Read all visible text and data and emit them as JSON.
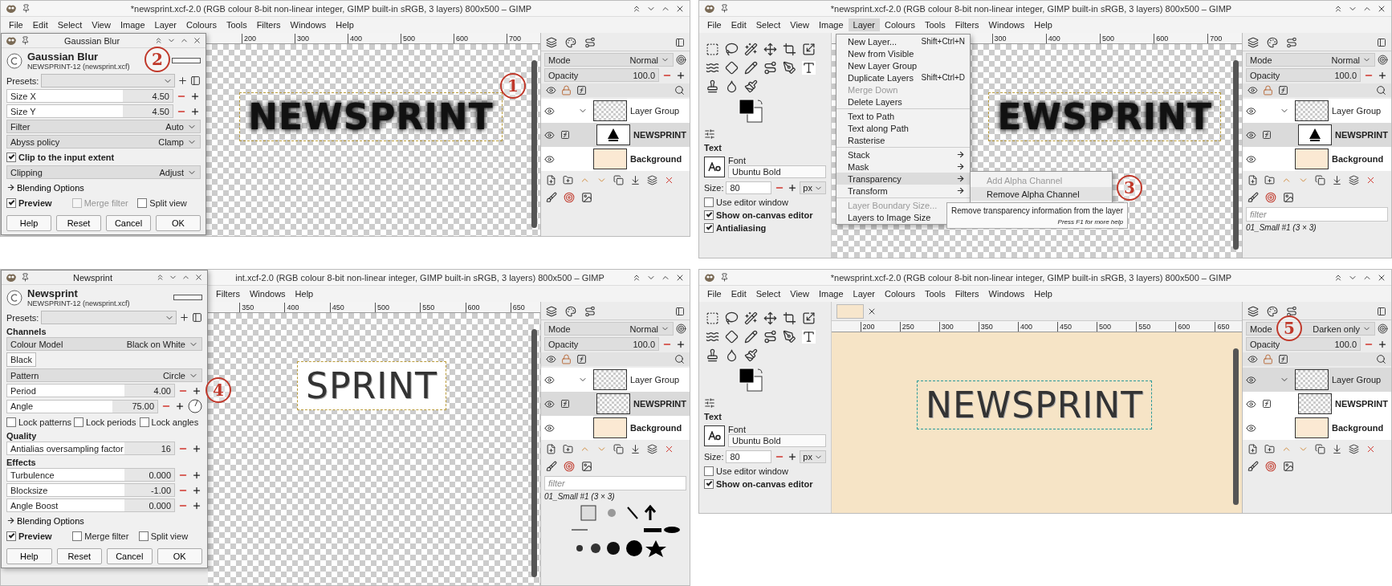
{
  "panels": [
    {
      "kind": "dialog",
      "title": "*newsprint.xcf-2.0 (RGB colour 8-bit non-linear integer, GIMP built-in sRGB, 3 layers) 800x500 – GIMP",
      "menu": [
        {
          "label": "File",
          "selected": false
        },
        {
          "label": "Edit",
          "selected": false
        },
        {
          "label": "Select",
          "selected": false
        },
        {
          "label": "View",
          "selected": false
        },
        {
          "label": "Image",
          "selected": false
        },
        {
          "label": "Layer",
          "selected": false
        },
        {
          "label": "Colours",
          "selected": false
        },
        {
          "label": "Tools",
          "selected": false
        },
        {
          "label": "Filters",
          "selected": false
        },
        {
          "label": "Windows",
          "selected": false
        },
        {
          "label": "Help",
          "selected": false
        }
      ],
      "dialog": {
        "title": "Gaussian Blur",
        "heading": "Gaussian Blur",
        "subtitle": "NEWSPRINT-12 (newsprint.xcf)",
        "presets_label": "Presets:",
        "callout": "2",
        "rows": [
          {
            "kind": "spin",
            "label": "Size X",
            "value": "4.50"
          },
          {
            "kind": "spin",
            "label": "Size Y",
            "value": "4.50"
          },
          {
            "kind": "combo",
            "label": "Filter",
            "value": "Auto"
          },
          {
            "kind": "combo",
            "label": "Abyss policy",
            "value": "Clamp"
          },
          {
            "kind": "check",
            "label": "Clip to the input extent",
            "checked": true
          },
          {
            "kind": "combo",
            "label": "Clipping",
            "value": "Adjust"
          },
          {
            "kind": "expander",
            "label": "Blending Options"
          },
          {
            "kind": "checks",
            "items": [
              {
                "label": "Preview",
                "checked": true,
                "disabled": false
              },
              {
                "label": "Merge filter",
                "checked": false,
                "disabled": true
              },
              {
                "label": "Split view",
                "checked": false,
                "disabled": false
              }
            ]
          }
        ],
        "buttons": [
          "Help",
          "Reset",
          "Cancel",
          "OK"
        ]
      },
      "canvas": {
        "kind": "blur-on-checker",
        "text": "NEWSPRINT",
        "callout": "1",
        "ruler": [
          "200",
          "300",
          "400",
          "500",
          "600",
          "700"
        ]
      },
      "dock": {
        "mode_label": "Mode",
        "mode": "Normal",
        "opacity_label": "Opacity",
        "opacity": "100.0",
        "layers": [
          {
            "name": "Layer Group",
            "selected": false,
            "fx": false,
            "kind": "group",
            "children": [
              {
                "name": "NEWSPRINT",
                "selected": true,
                "fx": true,
                "kind": "text"
              }
            ]
          },
          {
            "name": "Background",
            "selected": false,
            "fx": false,
            "kind": "fill"
          }
        ]
      }
    },
    {
      "kind": "menu",
      "title": "*newsprint.xcf-2.0 (RGB colour 8-bit non-linear integer, GIMP built-in sRGB, 3 layers) 800x500 – GIMP",
      "menu": [
        {
          "label": "File",
          "selected": false
        },
        {
          "label": "Edit",
          "selected": false
        },
        {
          "label": "Select",
          "selected": false
        },
        {
          "label": "View",
          "selected": false
        },
        {
          "label": "Image",
          "selected": false
        },
        {
          "label": "Layer",
          "selected": true
        },
        {
          "label": "Colours",
          "selected": false
        },
        {
          "label": "Tools",
          "selected": false
        },
        {
          "label": "Filters",
          "selected": false
        },
        {
          "label": "Windows",
          "selected": false
        },
        {
          "label": "Help",
          "selected": false
        }
      ],
      "toolbox": {
        "options_title": "Text",
        "font_label": "Font",
        "font": "Ubuntu Bold",
        "size_label": "Size:",
        "size": "80",
        "unit": "px",
        "checks": [
          {
            "label": "Use editor window",
            "checked": false
          },
          {
            "label": "Show on-canvas editor",
            "checked": true
          },
          {
            "label": "Antialiasing",
            "checked": true
          }
        ]
      },
      "popup": {
        "groups": [
          [
            {
              "label": "New Layer...",
              "shortcut": "Shift+Ctrl+N",
              "disabled": false,
              "selected": false,
              "arrow": false
            },
            {
              "label": "New from Visible",
              "disabled": false,
              "selected": false,
              "arrow": false
            },
            {
              "label": "New Layer Group",
              "disabled": false,
              "selected": false,
              "arrow": false
            },
            {
              "label": "Duplicate Layers",
              "shortcut": "Shift+Ctrl+D",
              "disabled": false,
              "selected": false,
              "arrow": false
            },
            {
              "label": "Merge Down",
              "disabled": true,
              "selected": false,
              "arrow": false
            },
            {
              "label": "Delete Layers",
              "disabled": false,
              "selected": false,
              "arrow": false
            }
          ],
          [
            {
              "label": "Text to Path",
              "disabled": false,
              "selected": false,
              "arrow": false
            },
            {
              "label": "Text along Path",
              "disabled": false,
              "selected": false,
              "arrow": false
            },
            {
              "label": "Rasterise",
              "disabled": false,
              "selected": false,
              "arrow": false
            }
          ],
          [
            {
              "label": "Stack",
              "disabled": false,
              "selected": false,
              "arrow": true
            },
            {
              "label": "Mask",
              "disabled": false,
              "selected": false,
              "arrow": true
            },
            {
              "label": "Transparency",
              "disabled": false,
              "selected": true,
              "arrow": true,
              "submenu": {
                "callout": "3",
                "items": [
                  {
                    "label": "Add Alpha Channel",
                    "disabled": true,
                    "selected": false
                  },
                  {
                    "label": "Remove Alpha Channel",
                    "disabled": false,
                    "selected": true
                  }
                ],
                "tooltip": {
                  "text": "Remove transparency information from the layer",
                  "hint": "Press F1 for more help"
                }
              }
            },
            {
              "label": "Transform",
              "disabled": false,
              "selected": false,
              "arrow": true
            }
          ],
          [
            {
              "label": "Layer Boundary Size...",
              "disabled": true,
              "selected": false,
              "arrow": false
            },
            {
              "label": "Layers to Image Size",
              "disabled": false,
              "selected": false,
              "arrow": false
            }
          ]
        ]
      },
      "canvas": {
        "kind": "blur-on-checker",
        "text": "EWSPRINT",
        "ruler": [
          "300",
          "400",
          "500",
          "600",
          "700"
        ]
      },
      "dock": {
        "mode_label": "Mode",
        "mode": "Normal",
        "opacity_label": "Opacity",
        "opacity": "100.0",
        "layers": [
          {
            "name": "Layer Group",
            "selected": false,
            "fx": false,
            "kind": "group",
            "children": [
              {
                "name": "NEWSPRINT",
                "selected": true,
                "fx": true,
                "kind": "text"
              }
            ]
          },
          {
            "name": "Background",
            "selected": false,
            "fx": false,
            "kind": "fill"
          }
        ],
        "filter_placeholder": "filter",
        "brush_name": "01_Small #1 (3 × 3)"
      }
    },
    {
      "kind": "dialog-tall",
      "title": "int.xcf-2.0 (RGB colour 8-bit non-linear integer, GIMP built-in sRGB, 3 layers) 800x500 – GIMP",
      "menu": [
        {
          "label": "Filters",
          "selected": false
        },
        {
          "label": "Windows",
          "selected": false
        },
        {
          "label": "Help",
          "selected": false
        }
      ],
      "dialog": {
        "title": "Newsprint",
        "heading": "Newsprint",
        "subtitle": "NEWSPRINT-12 (newsprint.xcf)",
        "presets_label": "Presets:",
        "rows": [
          {
            "kind": "section",
            "label": "Channels"
          },
          {
            "kind": "combo",
            "label": "Colour Model",
            "value": "Black on White"
          },
          {
            "kind": "tab",
            "label": "Black"
          },
          {
            "kind": "combo",
            "label": "Pattern",
            "value": "Circle"
          },
          {
            "kind": "spin",
            "label": "Period",
            "value": "4.00",
            "callout": "4"
          },
          {
            "kind": "dial",
            "label": "Angle",
            "value": "75.00"
          },
          {
            "kind": "checks",
            "items": [
              {
                "label": "Lock patterns",
                "checked": false,
                "disabled": false
              },
              {
                "label": "Lock periods",
                "checked": false,
                "disabled": false
              },
              {
                "label": "Lock angles",
                "checked": false,
                "disabled": false
              }
            ]
          },
          {
            "kind": "section",
            "label": "Quality"
          },
          {
            "kind": "spin",
            "label": "Antialias oversampling factor",
            "value": "16"
          },
          {
            "kind": "section",
            "label": "Effects"
          },
          {
            "kind": "spin",
            "label": "Turbulence",
            "value": "0.000"
          },
          {
            "kind": "spin",
            "label": "Blocksize",
            "value": "-1.00"
          },
          {
            "kind": "spin",
            "label": "Angle Boost",
            "value": "0.000"
          },
          {
            "kind": "expander",
            "label": "Blending Options"
          },
          {
            "kind": "checks",
            "items": [
              {
                "label": "Preview",
                "checked": true,
                "disabled": false
              },
              {
                "label": "Merge filter",
                "checked": false,
                "disabled": false
              },
              {
                "label": "Split view",
                "checked": false,
                "disabled": false
              }
            ]
          }
        ],
        "buttons": [
          "Help",
          "Reset",
          "Cancel",
          "OK"
        ]
      },
      "canvas": {
        "kind": "halftone-on-white",
        "text": "SPRINT",
        "ruler": [
          "350",
          "400",
          "450",
          "500",
          "550",
          "600",
          "650"
        ]
      },
      "dock": {
        "mode_label": "Mode",
        "mode": "Normal",
        "opacity_label": "Opacity",
        "opacity": "100.0",
        "layers": [
          {
            "name": "Layer Group",
            "selected": false,
            "fx": false,
            "kind": "group",
            "children": [
              {
                "name": "NEWSPRINT",
                "selected": true,
                "fx": true,
                "kind": "checker"
              }
            ]
          },
          {
            "name": "Background",
            "selected": false,
            "fx": false,
            "kind": "fill"
          }
        ],
        "filter_placeholder": "filter",
        "brush_name": "01_Small #1 (3 × 3)",
        "brush_grid": true
      }
    },
    {
      "kind": "plain",
      "title": "*newsprint.xcf-2.0 (RGB colour 8-bit non-linear integer, GIMP built-in sRGB, 3 layers) 800x500 – GIMP",
      "menu": [
        {
          "label": "File",
          "selected": false
        },
        {
          "label": "Edit",
          "selected": false
        },
        {
          "label": "Select",
          "selected": false
        },
        {
          "label": "View",
          "selected": false
        },
        {
          "label": "Image",
          "selected": false
        },
        {
          "label": "Layer",
          "selected": false
        },
        {
          "label": "Colours",
          "selected": false
        },
        {
          "label": "Tools",
          "selected": false
        },
        {
          "label": "Filters",
          "selected": false
        },
        {
          "label": "Windows",
          "selected": false
        },
        {
          "label": "Help",
          "selected": false
        }
      ],
      "toolbox": {
        "options_title": "Text",
        "font_label": "Font",
        "font": "Ubuntu Bold",
        "size_label": "Size:",
        "size": "80",
        "unit": "px",
        "checks": [
          {
            "label": "Use editor window",
            "checked": false
          },
          {
            "label": "Show on-canvas editor",
            "checked": true
          }
        ]
      },
      "canvas": {
        "kind": "halftone-on-paper",
        "text": "NEWSPRINT",
        "image_tab": true,
        "ruler": [
          "200",
          "250",
          "300",
          "350",
          "400",
          "450",
          "500",
          "550",
          "600",
          "650"
        ]
      },
      "dock": {
        "mode_label": "Mode",
        "mode": "Darken only",
        "opacity_label": "Opacity",
        "opacity": "100.0",
        "callout": "5",
        "layers": [
          {
            "name": "Layer Group",
            "selected": true,
            "fx": false,
            "kind": "group",
            "children": [
              {
                "name": "NEWSPRINT",
                "selected": false,
                "fx": true,
                "kind": "checker"
              }
            ]
          },
          {
            "name": "Background",
            "selected": false,
            "fx": false,
            "kind": "fill"
          }
        ]
      }
    }
  ]
}
